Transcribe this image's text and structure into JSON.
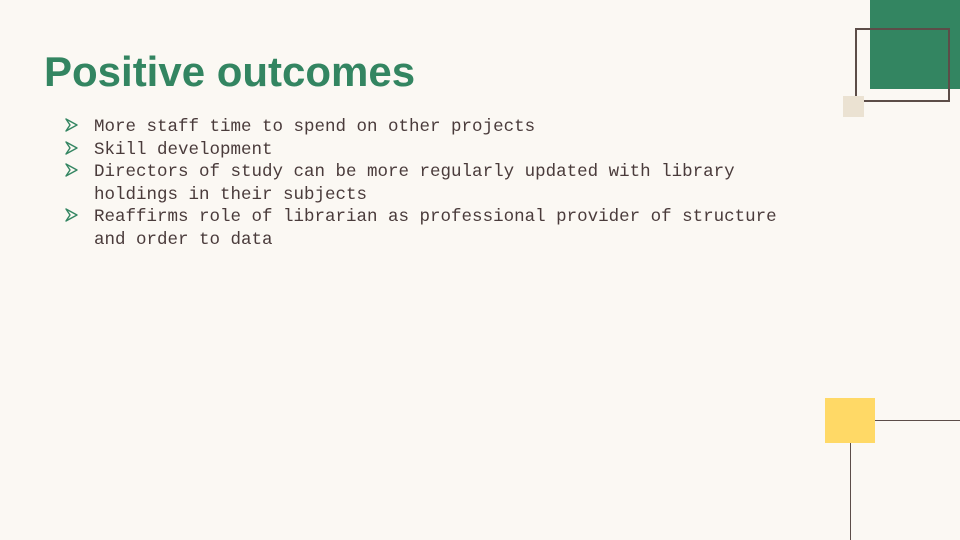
{
  "slide": {
    "title": "Positive outcomes",
    "bullets": [
      "More staff time to spend on other projects",
      "Skill development",
      "Directors of study can be more regularly updated with library holdings in their subjects",
      "Reaffirms role of librarian as professional provider of structure and order to data"
    ]
  },
  "colors": {
    "background": "#fbf8f3",
    "title": "#338561",
    "body_text": "#4a3b3b",
    "bullet_arrow": "#338561",
    "accent_green": "#338561",
    "accent_yellow": "#ffd966",
    "accent_beige": "#ebe2d2",
    "line": "#5c4d48"
  },
  "icons": {
    "bullet": "arrow-right-icon"
  }
}
